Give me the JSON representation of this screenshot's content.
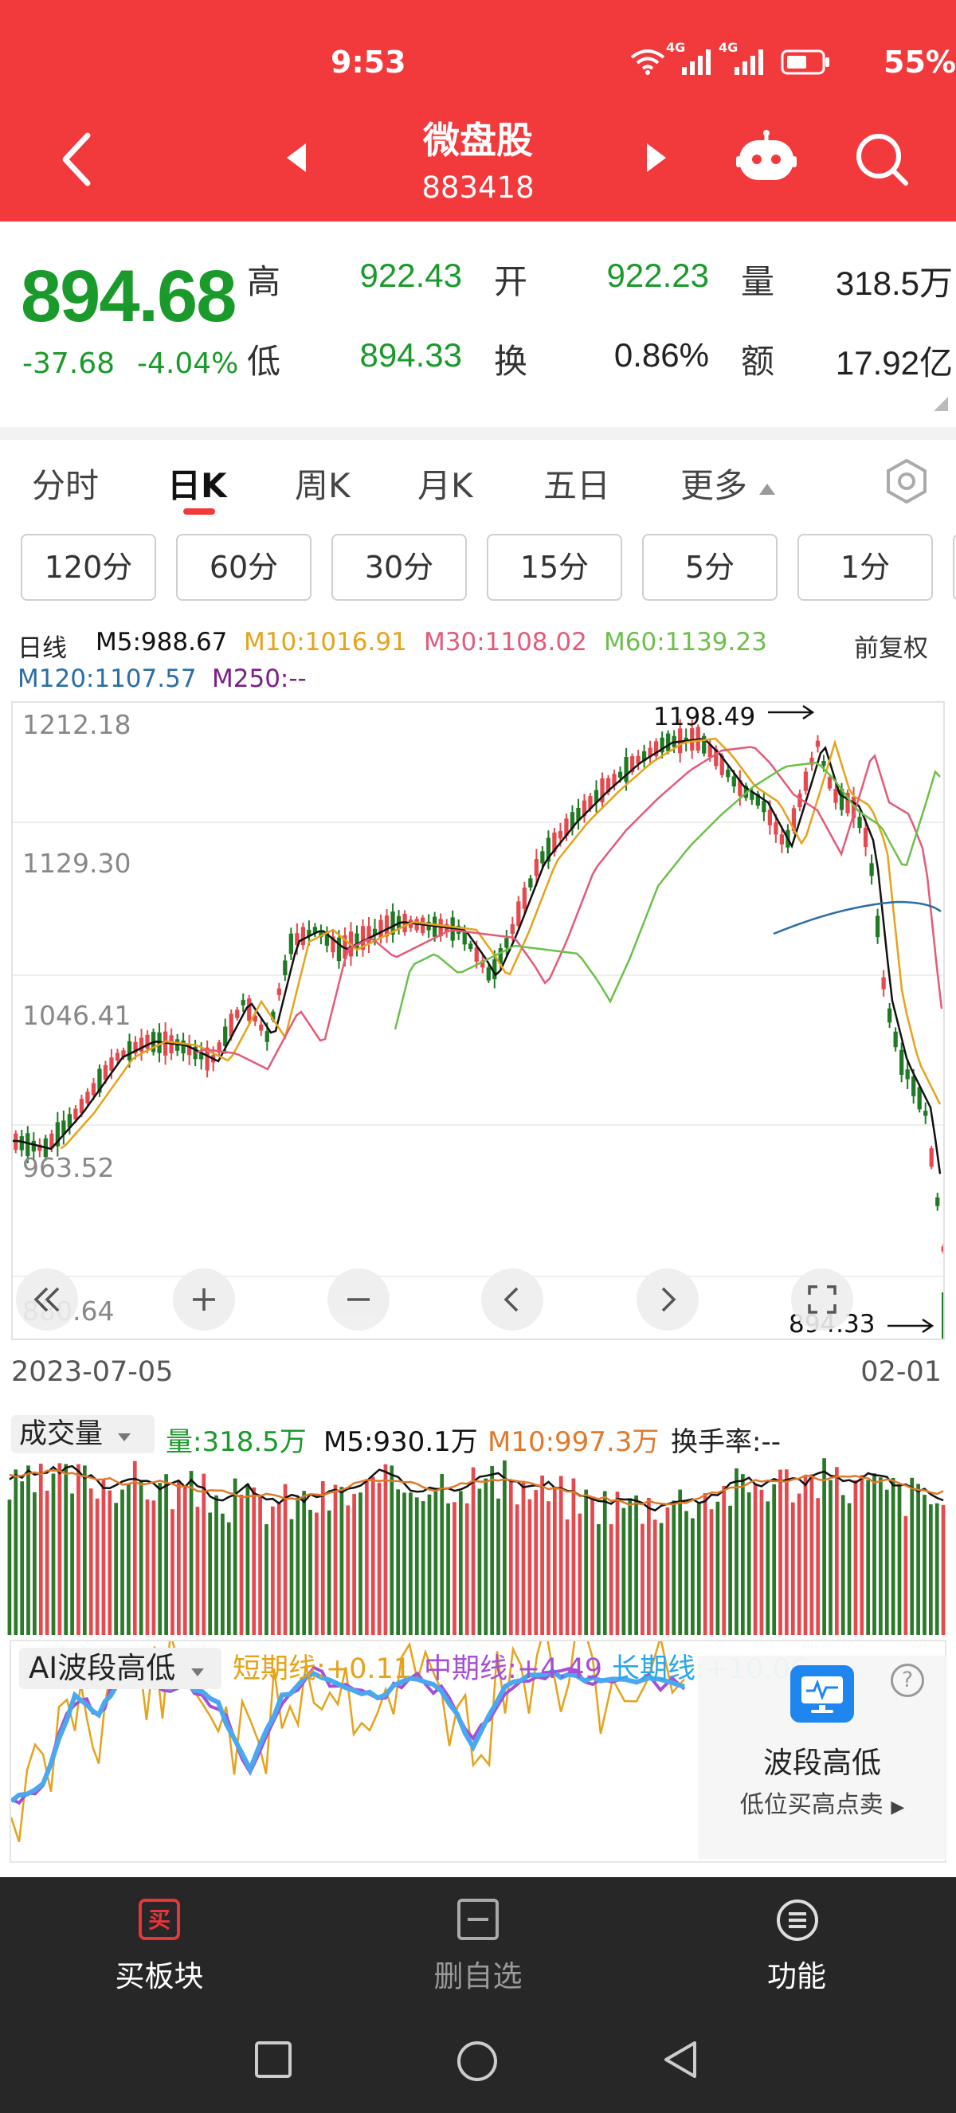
{
  "status": {
    "time": "9:53",
    "net1": "4G",
    "net2": "4G",
    "battery": "55%"
  },
  "header": {
    "title": "微盘股",
    "code": "883418"
  },
  "quote": {
    "price": "894.68",
    "change": "-37.68",
    "change_pct": "-4.04%",
    "high_label": "高",
    "high": "922.43",
    "open_label": "开",
    "open": "922.23",
    "vol_label": "量",
    "volume": "318.5万",
    "low_label": "低",
    "low": "894.33",
    "turn_label": "换",
    "turnover": "0.86%",
    "amt_label": "额",
    "amount": "17.92亿"
  },
  "tabs": [
    "分时",
    "日K",
    "周K",
    "月K",
    "五日",
    "更多"
  ],
  "minute_buttons": [
    "120分",
    "60分",
    "30分",
    "15分",
    "5分",
    "1分"
  ],
  "ma": {
    "label": "日线",
    "m5": "M5:988.67",
    "m10": "M10:1016.91",
    "m30": "M30:1108.02",
    "m60": "M60:1139.23",
    "m120": "M120:1107.57",
    "m250": "M250:--",
    "adjust": "前复权"
  },
  "chart": {
    "y_labels": [
      "1212.18",
      "1129.30",
      "1046.41",
      "963.52",
      "880.64"
    ],
    "high_marker": "1198.49",
    "low_marker": "894.33",
    "date_start": "2023-07-05",
    "date_end": "02-01"
  },
  "volume": {
    "selector": "成交量",
    "vol": "量:318.5万",
    "m5": "M5:930.1万",
    "m10": "M10:997.3万",
    "turnover": "换手率:--"
  },
  "ai": {
    "selector": "AI波段高低",
    "short": "短期线:+0.11",
    "mid": "中期线:+4.49",
    "long": "长期线:+10.06",
    "promo_title": "波段高低",
    "promo_sub": "低位买高点卖"
  },
  "bottom": {
    "buy": "买板块",
    "remove": "删自选",
    "func": "功能",
    "buy_icon_char": "买"
  },
  "colors": {
    "brand": "#f23a3c",
    "down": "#1a9a2a",
    "ma5": "#111111",
    "ma10": "#e6a21a",
    "ma30": "#e35a7a",
    "ma60": "#6cc04a",
    "ma120": "#2b6ea6",
    "ma250": "#7b1e8a"
  }
}
